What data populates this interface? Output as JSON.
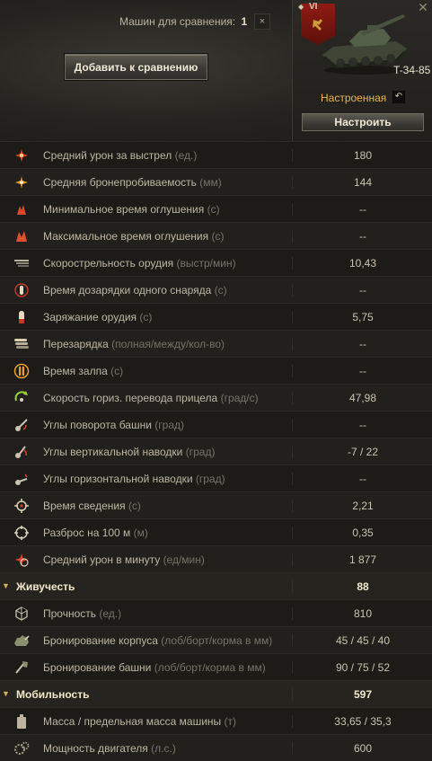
{
  "header": {
    "compare_label": "Машин для сравнения:",
    "compare_count": "1",
    "close_small": "×",
    "add_button": "Добавить к сравнению"
  },
  "tank": {
    "tier": "VI",
    "name": "T-34-85",
    "state": "Настроенная",
    "reset_icon": "↶",
    "setup_button": "Настроить",
    "close_icon": "✕"
  },
  "rows": [
    {
      "label": "Средний урон за выстрел",
      "unit": "(ед.)",
      "value": "180",
      "icon": "damage-icon"
    },
    {
      "label": "Средняя бронепробиваемость",
      "unit": "(мм)",
      "value": "144",
      "icon": "penetration-icon"
    },
    {
      "label": "Минимальное время оглушения",
      "unit": "(с)",
      "value": "--",
      "icon": "stun-min-icon"
    },
    {
      "label": "Максимальное время оглушения",
      "unit": "(с)",
      "value": "--",
      "icon": "stun-max-icon"
    },
    {
      "label": "Скорострельность орудия",
      "unit": "(выстр/мин)",
      "value": "10,43",
      "icon": "rate-of-fire-icon"
    },
    {
      "label": "Время дозарядки одного снаряда",
      "unit": "(с)",
      "value": "--",
      "icon": "intra-clip-reload-icon"
    },
    {
      "label": "Заряжание орудия",
      "unit": "(с)",
      "value": "5,75",
      "icon": "reload-icon"
    },
    {
      "label": "Перезарядка",
      "unit": "(полная/между/кол-во)",
      "value": "--",
      "icon": "clip-reload-icon"
    },
    {
      "label": "Время залпа",
      "unit": "(с)",
      "value": "--",
      "icon": "salvo-icon"
    },
    {
      "label": "Скорость гориз. перевода прицела",
      "unit": "(град/с)",
      "value": "47,98",
      "icon": "traverse-speed-icon"
    },
    {
      "label": "Углы поворота башни",
      "unit": "(град)",
      "value": "--",
      "icon": "turret-angles-icon"
    },
    {
      "label": "Углы вертикальной наводки",
      "unit": "(град)",
      "value": "-7 / 22",
      "icon": "elevation-icon"
    },
    {
      "label": "Углы горизонтальной наводки",
      "unit": "(град)",
      "value": "--",
      "icon": "horizontal-angles-icon"
    },
    {
      "label": "Время сведения",
      "unit": "(с)",
      "value": "2,21",
      "icon": "aim-time-icon"
    },
    {
      "label": "Разброс на 100 м",
      "unit": "(м)",
      "value": "0,35",
      "icon": "dispersion-icon"
    },
    {
      "label": "Средний урон в минуту",
      "unit": "(ед/мин)",
      "value": "1 877",
      "icon": "dpm-icon"
    }
  ],
  "survivability": {
    "title": "Живучесть",
    "value": "88",
    "rows": [
      {
        "label": "Прочность",
        "unit": "(ед.)",
        "value": "810",
        "icon": "hitpoints-icon"
      },
      {
        "label": "Бронирование корпуса",
        "unit": "(лоб/борт/корма в мм)",
        "value": "45 / 45 / 40",
        "icon": "hull-armor-icon"
      },
      {
        "label": "Бронирование башни",
        "unit": "(лоб/борт/корма в мм)",
        "value": "90 / 75 / 52",
        "icon": "turret-armor-icon"
      }
    ]
  },
  "mobility": {
    "title": "Мобильность",
    "value": "597",
    "rows": [
      {
        "label": "Масса / предельная масса машины",
        "unit": "(т)",
        "value": "33,65 / 35,3",
        "icon": "weight-icon"
      },
      {
        "label": "Мощность двигателя",
        "unit": "(л.с.)",
        "value": "600",
        "icon": "engine-power-icon"
      }
    ]
  },
  "colors": {
    "accent": "#e8b45a",
    "group_title": "#f1e9cc",
    "icon_red": "#e0402a",
    "icon_orange": "#f0a030",
    "icon_green": "#9bd13a"
  }
}
